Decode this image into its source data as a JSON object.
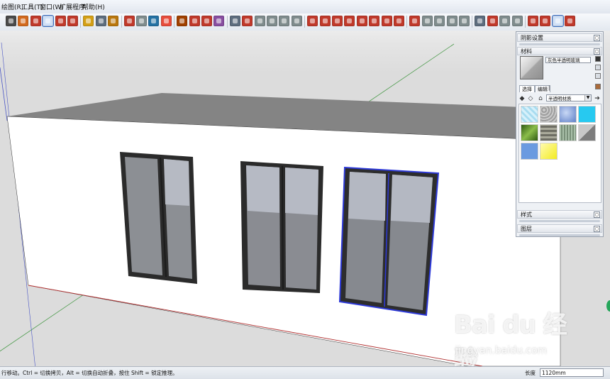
{
  "menu": {
    "items": [
      "绘图(R)",
      "工具(T)",
      "窗口(W)",
      "扩展程序",
      "帮助(H)"
    ]
  },
  "toolbar": {
    "buttons": [
      {
        "icon": "select-arrow-icon",
        "color": "#4a4a4a"
      },
      {
        "icon": "eraser-icon",
        "color": "#d2691e"
      },
      {
        "icon": "paint-bucket-icon",
        "color": "#c0392b"
      },
      {
        "icon": "move-icon",
        "color": "#d64541",
        "active": true
      },
      {
        "icon": "rotate-icon",
        "color": "#c0392b"
      },
      {
        "icon": "scale-icon",
        "color": "#c0392b"
      },
      {
        "icon": "tape-measure-icon",
        "color": "#d4a017"
      },
      {
        "icon": "text-icon",
        "color": "#5d6d7e"
      },
      {
        "icon": "paint-icon",
        "color": "#b9770e"
      },
      {
        "icon": "orbit-icon",
        "color": "#c0392b"
      },
      {
        "icon": "pan-icon",
        "color": "#7f8c8d"
      },
      {
        "icon": "zoom-icon",
        "color": "#2471a3"
      },
      {
        "icon": "zoom-extents-icon",
        "color": "#e74c3c"
      },
      {
        "icon": "component-icon",
        "color": "#a04000"
      },
      {
        "icon": "warehouse-icon",
        "color": "#c0392b"
      },
      {
        "icon": "share-icon",
        "color": "#c0392b"
      },
      {
        "icon": "extension-icon",
        "color": "#884ea0"
      },
      {
        "icon": "iso-view-icon",
        "color": "#5d6d7e"
      },
      {
        "icon": "top-view-icon",
        "color": "#c0392b"
      },
      {
        "icon": "front-view-icon",
        "color": "#7f8c8d"
      },
      {
        "icon": "right-view-icon",
        "color": "#7f8c8d"
      },
      {
        "icon": "back-view-icon",
        "color": "#7f8c8d"
      },
      {
        "icon": "left-view-icon",
        "color": "#7f8c8d"
      },
      {
        "icon": "sandbox-contours-icon",
        "color": "#c0392b"
      },
      {
        "icon": "sandbox-scratch-icon",
        "color": "#c0392b"
      },
      {
        "icon": "smoove-icon",
        "color": "#c0392b"
      },
      {
        "icon": "stamp-icon",
        "color": "#c0392b"
      },
      {
        "icon": "drape-icon",
        "color": "#c0392b"
      },
      {
        "icon": "add-detail-icon",
        "color": "#c0392b"
      },
      {
        "icon": "flip-edge-icon",
        "color": "#c0392b"
      },
      {
        "icon": "follow-me-icon",
        "color": "#c0392b"
      },
      {
        "icon": "offset-icon",
        "color": "#c0392b"
      },
      {
        "icon": "solid-union-icon",
        "color": "#7f8c8d"
      },
      {
        "icon": "solid-subtract-icon",
        "color": "#7f8c8d"
      },
      {
        "icon": "solid-trim-icon",
        "color": "#7f8c8d"
      },
      {
        "icon": "solid-split-icon",
        "color": "#7f8c8d"
      },
      {
        "icon": "photo-match-icon",
        "color": "#5d6d7e"
      },
      {
        "icon": "section-plane-icon",
        "color": "#c0392b"
      },
      {
        "icon": "sketchy-edges-icon",
        "color": "#7f8c8d"
      },
      {
        "icon": "style-icon",
        "color": "#7f8c8d"
      },
      {
        "icon": "shadow-icon",
        "color": "#c0392b"
      },
      {
        "icon": "layers-icon",
        "color": "#c0392b"
      },
      {
        "icon": "materials-icon",
        "color": "#e74c3c",
        "active": true
      },
      {
        "icon": "ruby-icon",
        "color": "#c0392b"
      }
    ]
  },
  "tray": {
    "shadow_panel": "阴影设置",
    "materials_panel": "材料",
    "material_name": "灰色半透明玻璃",
    "tab_select": "选择",
    "tab_edit": "编辑",
    "tab_sep": "|",
    "library": "半透明材质",
    "styles_panel": "样式",
    "layers_panel": "图层",
    "swatches": [
      {
        "name": "translucent-light-blue",
        "color": "#bde6f4"
      },
      {
        "name": "translucent-pattern",
        "color": "#bdbdbd"
      },
      {
        "name": "translucent-cloud-blue",
        "color": "#6f8fd0"
      },
      {
        "name": "translucent-cyan",
        "color": "#27c9f0"
      },
      {
        "name": "translucent-green",
        "color": "#4f7f2a"
      },
      {
        "name": "translucent-glass-block",
        "color": "#8a8a7a"
      },
      {
        "name": "translucent-ribbed",
        "color": "#a9c0a9"
      },
      {
        "name": "translucent-gray",
        "color": "#9b9b9b"
      },
      {
        "name": "translucent-blue",
        "color": "#6a9ae0"
      },
      {
        "name": "translucent-yellow",
        "color": "#f5f03a"
      }
    ]
  },
  "status": {
    "message": "行移动。Ctrl = 切换拷贝，Alt = 切换自动折叠，按住 Shift = 锁定推理。",
    "length_label": "长度",
    "length_value": "1120mm"
  },
  "watermark": {
    "logo": "Bai du 经验",
    "url": "jingyan.baidu.com"
  }
}
